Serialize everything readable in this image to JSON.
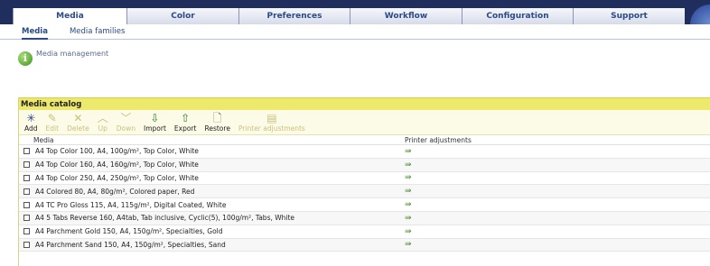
{
  "top_tabs": [
    {
      "label": "Media",
      "active": true
    },
    {
      "label": "Color",
      "active": false
    },
    {
      "label": "Preferences",
      "active": false
    },
    {
      "label": "Workflow",
      "active": false
    },
    {
      "label": "Configuration",
      "active": false
    },
    {
      "label": "Support",
      "active": false
    }
  ],
  "sub_tabs": [
    {
      "label": "Media",
      "active": true
    },
    {
      "label": "Media families",
      "active": false
    }
  ],
  "info": {
    "icon": "info-icon",
    "text": "Media management"
  },
  "catalog": {
    "title": "Media catalog",
    "toolbar": [
      {
        "label": "Add",
        "icon": "add-icon",
        "enabled": true
      },
      {
        "label": "Edit",
        "icon": "edit-icon",
        "enabled": false
      },
      {
        "label": "Delete",
        "icon": "delete-icon",
        "enabled": false
      },
      {
        "label": "Up",
        "icon": "up-icon",
        "enabled": false
      },
      {
        "label": "Down",
        "icon": "down-icon",
        "enabled": false
      },
      {
        "label": "Import",
        "icon": "import-icon",
        "enabled": true
      },
      {
        "label": "Export",
        "icon": "export-icon",
        "enabled": true
      },
      {
        "label": "Restore",
        "icon": "restore-icon",
        "enabled": true
      },
      {
        "label": "Printer adjustments",
        "icon": "printer-adjustments-icon",
        "enabled": false
      }
    ],
    "columns": {
      "media": "Media",
      "printer_adjustments": "Printer adjustments"
    },
    "rows": [
      {
        "name": "A4 Top Color 100, A4, 100g/m², Top Color, White"
      },
      {
        "name": "A4 Top Color 160, A4, 160g/m², Top Color, White"
      },
      {
        "name": "A4 Top Color 250, A4, 250g/m², Top Color, White"
      },
      {
        "name": "A4 Colored 80, A4, 80g/m², Colored paper, Red"
      },
      {
        "name": "A4 TC Pro Gloss 115, A4, 115g/m², Digital Coated, White"
      },
      {
        "name": "A4 5 Tabs Reverse 160, A4tab, Tab inclusive, Cyclic(5), 100g/m², Tabs, White"
      },
      {
        "name": "A4 Parchment Gold 150, A4, 150g/m², Specialties, Gold"
      },
      {
        "name": "A4 Parchment Sand 150, A4, 150g/m², Specialties, Sand"
      }
    ]
  }
}
